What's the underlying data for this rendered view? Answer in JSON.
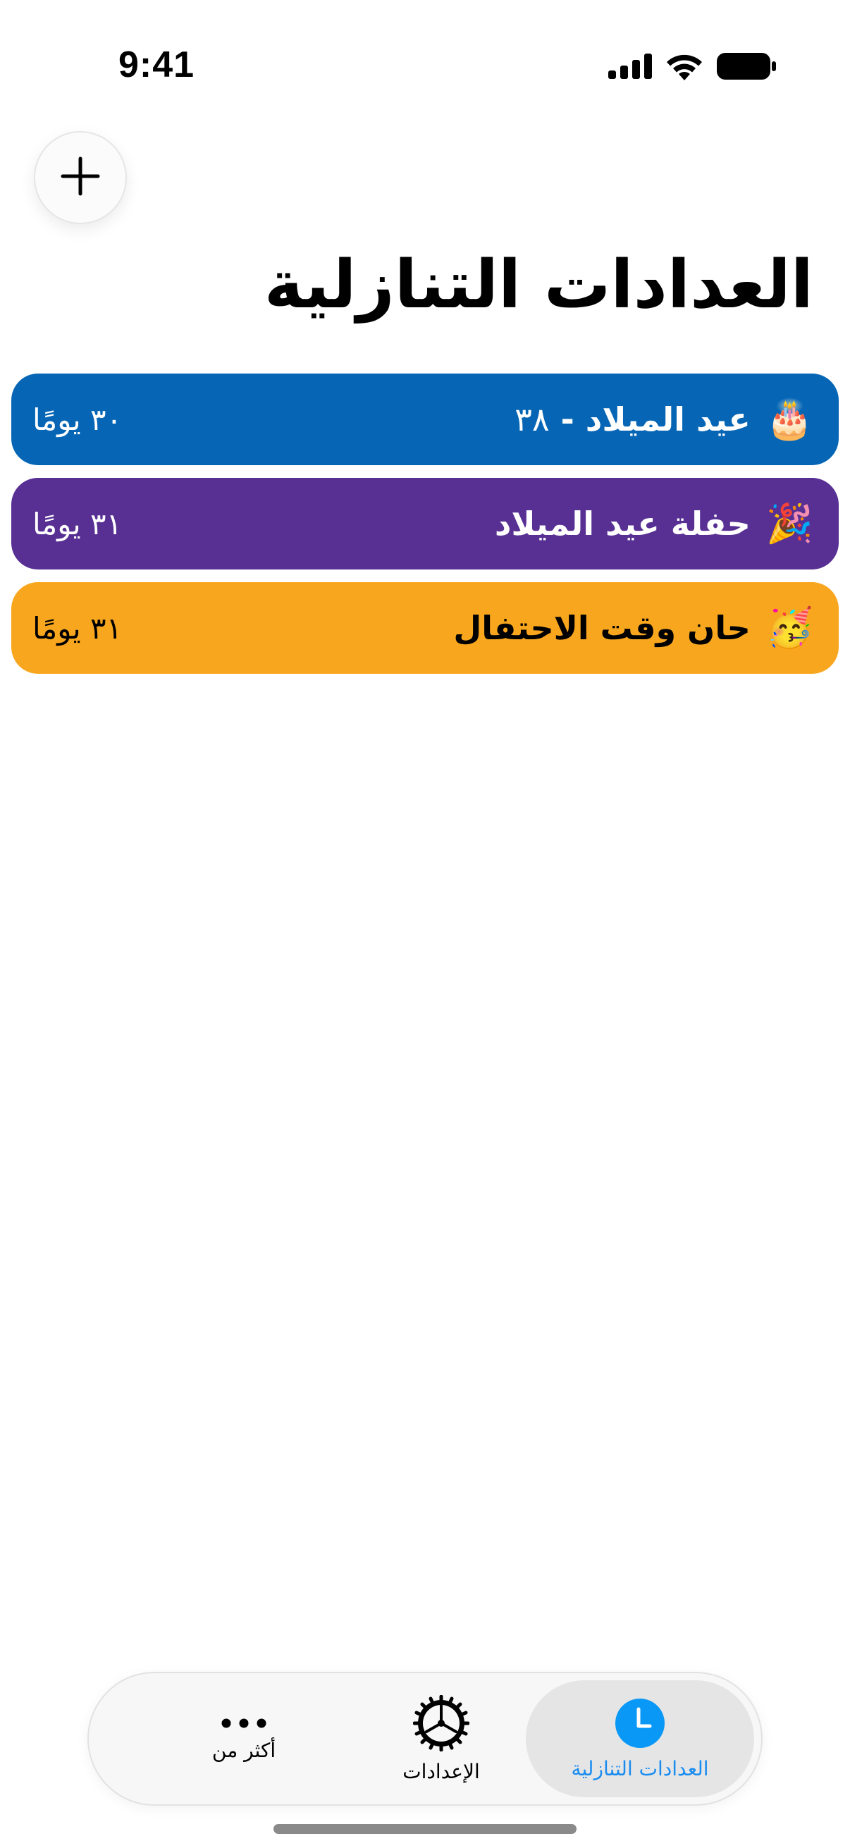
{
  "status_bar": {
    "time": "9:41",
    "icons": [
      "signal-icon",
      "wifi-icon",
      "battery-icon"
    ]
  },
  "toolbar": {
    "add_icon": "plus-icon"
  },
  "page": {
    "title": "العدادات التنازلية"
  },
  "countdowns": [
    {
      "emoji": "🎂",
      "name": "عيد الميلاد -",
      "age": "٣٨",
      "days": "٣٠ يومًا",
      "color": "#0666b5",
      "text_color": "#ffffff"
    },
    {
      "emoji": "🎉",
      "name": "حفلة عيد الميلاد",
      "days": "٣١ يومًا",
      "color": "#583094",
      "text_color": "#ffffff"
    },
    {
      "emoji": "🥳",
      "name": "حان وقت الاحتفال",
      "days": "٣١ يومًا",
      "color": "#f8a61e",
      "text_color": "#000000"
    }
  ],
  "tab_bar": {
    "tabs": [
      {
        "label": "العدادات التنازلية",
        "icon": "clock-icon",
        "selected": true
      },
      {
        "label": "الإعدادات",
        "icon": "gear-icon",
        "selected": false
      },
      {
        "label": "أكثر من",
        "icon": "more-icon",
        "selected": false
      }
    ],
    "accent": "#1a8cf0"
  }
}
